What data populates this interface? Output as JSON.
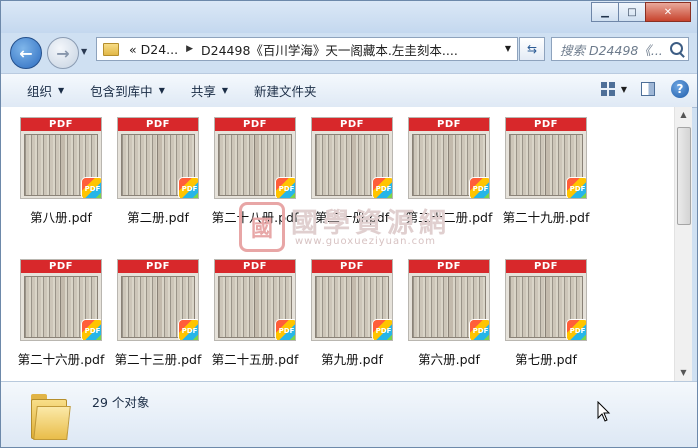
{
  "window": {
    "controls": {
      "minimize": "▁",
      "maximize": "□",
      "close": "✕"
    }
  },
  "nav": {
    "back_glyph": "←",
    "forward_glyph": "→",
    "breadcrumb_prefix": "«",
    "breadcrumb": [
      "D24...",
      "D24498《百川学海》天一阁藏本.左圭刻本...."
    ],
    "search_placeholder": "搜索 D24498《..."
  },
  "toolbar": {
    "organize": "组织",
    "include_in_library": "包含到库中",
    "share": "共享",
    "new_folder": "新建文件夹",
    "help": "?"
  },
  "files": [
    {
      "name": "第八册.pdf",
      "thumb_label": "PDF",
      "badge": "PDF"
    },
    {
      "name": "第二册.pdf",
      "thumb_label": "PDF",
      "badge": "PDF"
    },
    {
      "name": "第二十八册.pdf",
      "thumb_label": "PDF",
      "badge": "PDF"
    },
    {
      "name": "第二十册.pdf",
      "thumb_label": "PDF",
      "badge": "PDF"
    },
    {
      "name": "第二十二册.pdf",
      "thumb_label": "PDF",
      "badge": "PDF"
    },
    {
      "name": "第二十九册.pdf",
      "thumb_label": "PDF",
      "badge": "PDF"
    },
    {
      "name": "第二十六册.pdf",
      "thumb_label": "PDF",
      "badge": "PDF"
    },
    {
      "name": "第二十三册.pdf",
      "thumb_label": "PDF",
      "badge": "PDF"
    },
    {
      "name": "第二十五册.pdf",
      "thumb_label": "PDF",
      "badge": "PDF"
    },
    {
      "name": "第九册.pdf",
      "thumb_label": "PDF",
      "badge": "PDF"
    },
    {
      "name": "第六册.pdf",
      "thumb_label": "PDF",
      "badge": "PDF"
    },
    {
      "name": "第七册.pdf",
      "thumb_label": "PDF",
      "badge": "PDF"
    }
  ],
  "watermark": {
    "logo_char": "國",
    "title": "國學資源網",
    "url": "www.guoxueziyuan.com"
  },
  "status": {
    "item_count": "29 个对象"
  },
  "colors": {
    "pdf_red": "#d8282b",
    "nav_blue": "#2d6cc0",
    "folder_yellow": "#e9bd4a"
  }
}
